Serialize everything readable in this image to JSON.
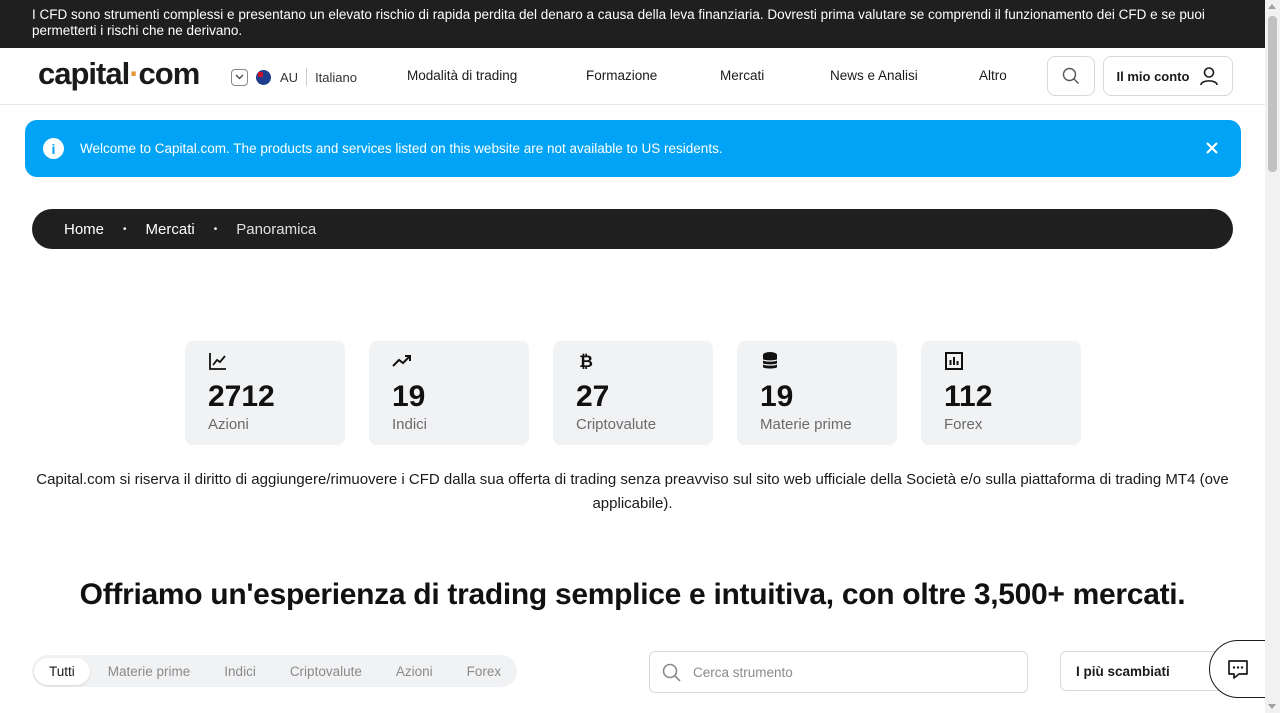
{
  "risk_warning": "I CFD sono strumenti complessi e presentano un elevato rischio di rapida perdita del denaro a causa della leva finanziaria. Dovresti prima valutare se comprendi il funzionamento dei CFD e se puoi permetterti i rischi che ne derivano.",
  "header": {
    "logo_left": "capital",
    "logo_dot": "·",
    "logo_right": "com",
    "region": "AU",
    "language": "Italiano",
    "nav": [
      "Modalità di trading",
      "Formazione",
      "Mercati",
      "News e Analisi",
      "Altro"
    ],
    "account_label": "Il mio conto"
  },
  "welcome_banner": {
    "text": "Welcome to Capital.com. The products and services listed on this website are not available to US residents."
  },
  "breadcrumb": {
    "items": [
      "Home",
      "Mercati",
      "Panoramica"
    ],
    "separator": "•"
  },
  "stats": [
    {
      "icon": "line-chart-icon",
      "value": "2712",
      "label": "Azioni"
    },
    {
      "icon": "trending-up-icon",
      "value": "19",
      "label": "Indici"
    },
    {
      "icon": "bitcoin-icon",
      "value": "27",
      "label": "Criptovalute"
    },
    {
      "icon": "database-icon",
      "value": "19",
      "label": "Materie prime"
    },
    {
      "icon": "bar-chart-icon",
      "value": "112",
      "label": "Forex"
    }
  ],
  "disclaimer": "Capital.com si riserva il diritto di aggiungere/rimuovere i CFD dalla sua offerta di trading senza preavviso sul sito web ufficiale della Società e/o sulla piattaforma di trading MT4 (ove applicabile).",
  "headline": "Offriamo un'esperienza di trading semplice e intuitiva, con oltre 3,500+ mercati.",
  "filter_tabs": [
    "Tutti",
    "Materie prime",
    "Indici",
    "Criptovalute",
    "Azioni",
    "Forex"
  ],
  "search": {
    "placeholder": "Cerca strumento"
  },
  "sort": {
    "selected": "I più scambiati"
  },
  "colors": {
    "accent": "#00a3f5",
    "dark": "#1f1f1f",
    "logo_dot": "#e79a3b"
  }
}
